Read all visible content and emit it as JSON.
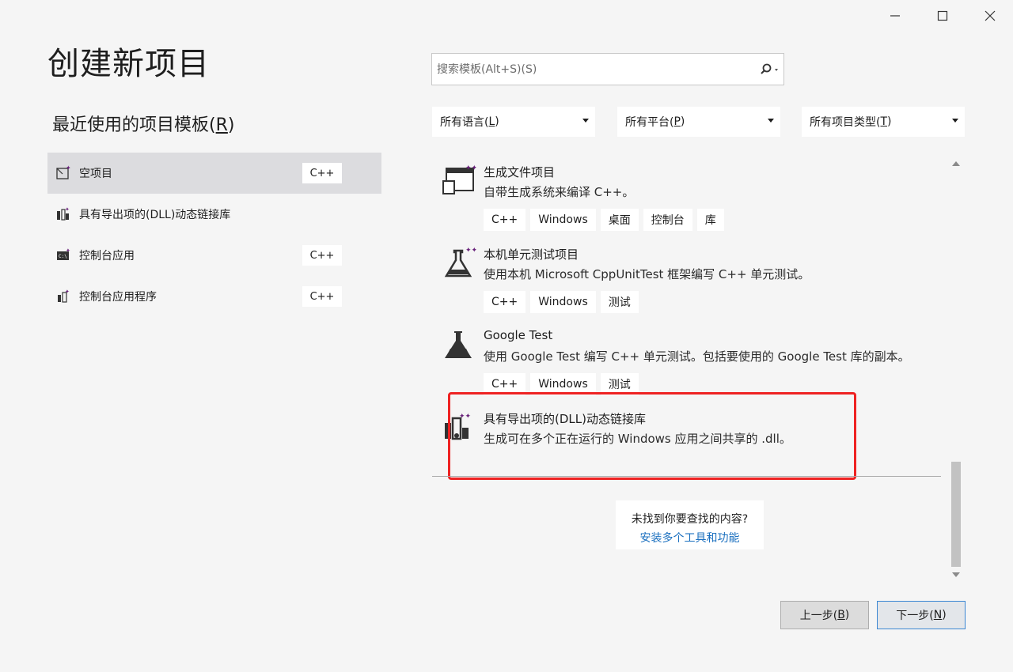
{
  "window": {
    "minimize_icon": "minimize-icon",
    "maximize_icon": "maximize-icon",
    "close_icon": "close-icon"
  },
  "title": "创建新项目",
  "recent": {
    "heading_main": "最近使用的项目模板(",
    "heading_key": "R",
    "heading_end": ")",
    "items": [
      {
        "label": "空项目",
        "lang": "C++",
        "icon": "empty-project-icon",
        "selected": true
      },
      {
        "label": "具有导出项的(DLL)动态链接库",
        "lang": "",
        "icon": "dll-icon",
        "selected": false
      },
      {
        "label": "控制台应用",
        "lang": "C++",
        "icon": "console-app-icon",
        "selected": false
      },
      {
        "label": "控制台应用程序",
        "lang": "C++",
        "icon": "console-program-icon",
        "selected": false
      }
    ]
  },
  "search": {
    "placeholder": "搜索模板(Alt+S)(S)",
    "icon": "search-icon"
  },
  "filters": {
    "language": {
      "main": "所有语言(",
      "key": "L",
      "end": ")"
    },
    "platform": {
      "main": "所有平台(",
      "key": "P",
      "end": ")"
    },
    "type": {
      "main": "所有项目类型(",
      "key": "T",
      "end": ")"
    }
  },
  "templates": [
    {
      "name": "生成文件项目",
      "desc": "自带生成系统来编译 C++。",
      "tags": [
        "C++",
        "Windows",
        "桌面",
        "控制台",
        "库"
      ],
      "icon": "makefile-project-icon"
    },
    {
      "name": "本机单元测试项目",
      "desc": "使用本机 Microsoft CppUnitTest 框架编写 C++ 单元测试。",
      "tags": [
        "C++",
        "Windows",
        "测试"
      ],
      "icon": "unit-test-flask-icon"
    },
    {
      "name": "Google Test",
      "desc": "使用 Google Test 编写 C++ 单元测试。包括要使用的 Google Test 库的副本。",
      "tags": [
        "C++",
        "Windows",
        "测试"
      ],
      "icon": "google-test-flask-icon"
    },
    {
      "name": "具有导出项的(DLL)动态链接库",
      "desc": "生成可在多个正在运行的 Windows 应用之间共享的 .dll。",
      "tags": [],
      "icon": "dll-icon"
    }
  ],
  "not_found": {
    "question": "未找到你要查找的内容?",
    "link": "安装多个工具和功能"
  },
  "buttons": {
    "back": {
      "main": "上一步(",
      "key": "B",
      "end": ")"
    },
    "next": {
      "main": "下一步(",
      "key": "N",
      "end": ")"
    }
  },
  "colors": {
    "highlight": "#ee2222",
    "link": "#1a6fbf",
    "accent_purple": "#68217a"
  }
}
